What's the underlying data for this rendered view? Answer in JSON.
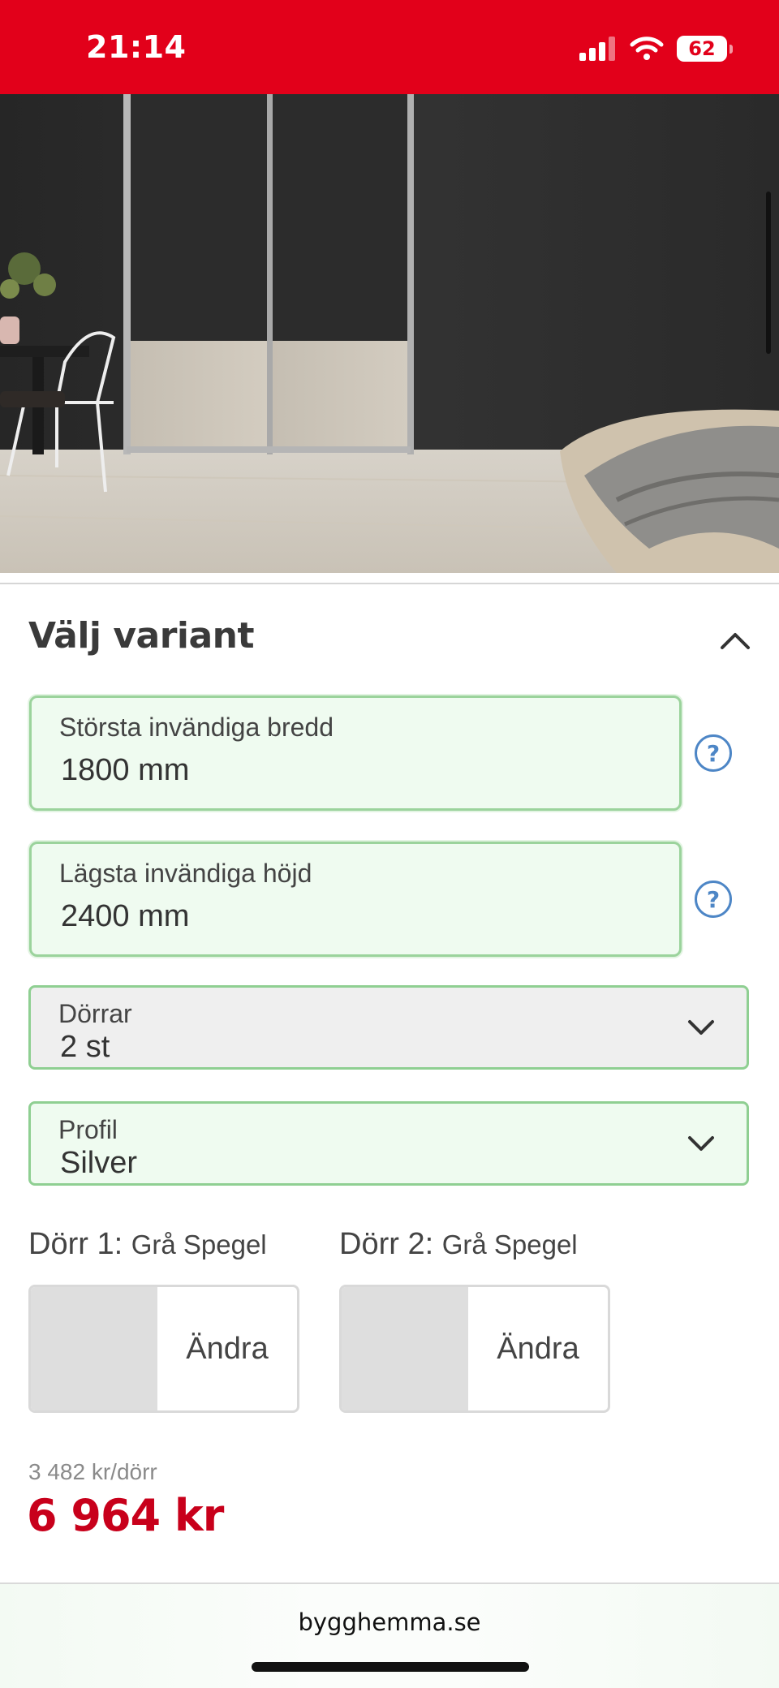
{
  "status_bar": {
    "time": "21:14",
    "battery": "62"
  },
  "variant": {
    "title": "Välj variant",
    "width_field": {
      "label": "Största invändiga bredd",
      "value": "1800 mm"
    },
    "height_field": {
      "label": "Lägsta invändiga höjd",
      "value": "2400 mm"
    },
    "help_glyph": "?",
    "doors_select": {
      "label": "Dörrar",
      "value": "2 st"
    },
    "profile_select": {
      "label": "Profil",
      "value": "Silver"
    },
    "door1": {
      "label": "Dörr 1:",
      "color": "Grå Spegel",
      "change_label": "Ändra"
    },
    "door2": {
      "label": "Dörr 2:",
      "color": "Grå Spegel",
      "change_label": "Ändra"
    },
    "unit_price": "3 482 kr/dörr",
    "total_price": "6 964 kr"
  },
  "browser": {
    "url": "bygghemma.se"
  },
  "colors": {
    "brand_red": "#e2001a",
    "price_red": "#c8001b",
    "field_bg": "#effbf0",
    "field_border": "#9bd39c",
    "help_blue": "#4d86c6"
  }
}
